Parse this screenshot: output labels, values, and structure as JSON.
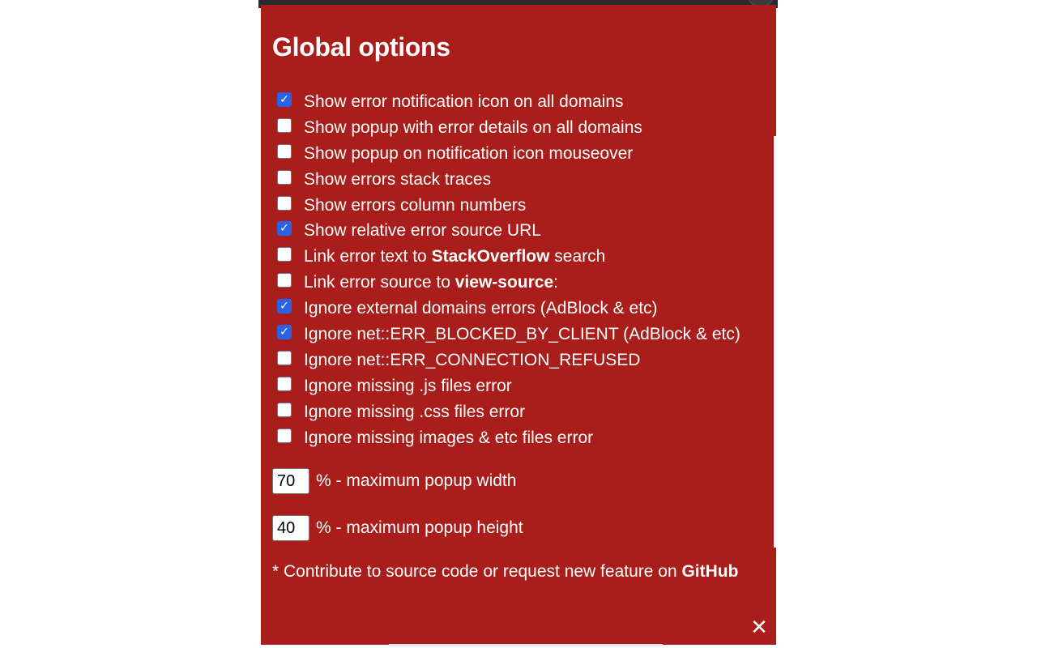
{
  "panel": {
    "title": "Global options",
    "accent_color": "#a91e1a",
    "checkbox_color": "#2b63e6"
  },
  "options": [
    {
      "pre": "Show error notification icon on all domains",
      "bold": "",
      "post": "",
      "checked": true
    },
    {
      "pre": "Show popup with error details on all domains",
      "bold": "",
      "post": "",
      "checked": false
    },
    {
      "pre": "Show popup on notification icon mouseover",
      "bold": "",
      "post": "",
      "checked": false
    },
    {
      "pre": "Show errors stack traces",
      "bold": "",
      "post": "",
      "checked": false
    },
    {
      "pre": "Show errors column numbers",
      "bold": "",
      "post": "",
      "checked": false
    },
    {
      "pre": "Show relative error source URL",
      "bold": "",
      "post": "",
      "checked": true
    },
    {
      "pre": "Link error text to ",
      "bold": "StackOverflow",
      "post": " search",
      "checked": false
    },
    {
      "pre": "Link error source to ",
      "bold": "view-source",
      "post": ":",
      "checked": false
    },
    {
      "pre": "Ignore external domains errors (AdBlock & etc)",
      "bold": "",
      "post": "",
      "checked": true
    },
    {
      "pre": "Ignore net::ERR_BLOCKED_BY_CLIENT (AdBlock & etc)",
      "bold": "",
      "post": "",
      "checked": true
    },
    {
      "pre": "Ignore net::ERR_CONNECTION_REFUSED",
      "bold": "",
      "post": "",
      "checked": false
    },
    {
      "pre": "Ignore missing .js files error",
      "bold": "",
      "post": "",
      "checked": false
    },
    {
      "pre": "Ignore missing .css files error",
      "bold": "",
      "post": "",
      "checked": false
    },
    {
      "pre": "Ignore missing images & etc files error",
      "bold": "",
      "post": "",
      "checked": false
    }
  ],
  "popup_width": {
    "value": "70",
    "label": "% - maximum popup width"
  },
  "popup_height": {
    "value": "40",
    "label": "% - maximum popup height"
  },
  "footer": {
    "text": "* Contribute to source code or request new feature on ",
    "link_label": "GitHub"
  },
  "close": {
    "glyph": "✕",
    "icon": "close-icon"
  }
}
